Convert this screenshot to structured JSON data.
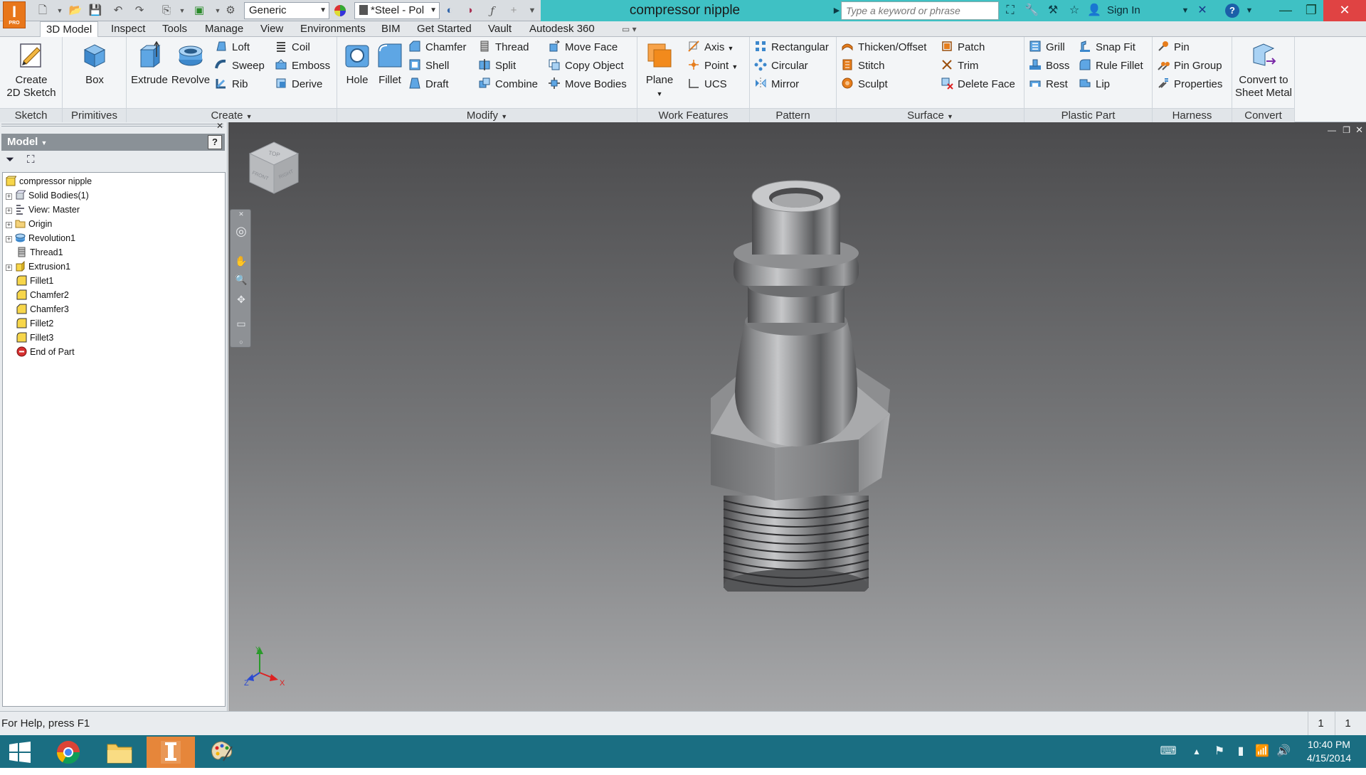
{
  "title_bar": {
    "document_title": "compressor nipple",
    "material": "Generic",
    "appearance": "*Steel - Pol",
    "search_placeholder": "Type a keyword or phrase",
    "sign_in": "Sign In",
    "app_badge": "PRO"
  },
  "tabs": [
    "3D Model",
    "Inspect",
    "Tools",
    "Manage",
    "View",
    "Environments",
    "BIM",
    "Get Started",
    "Vault",
    "Autodesk 360"
  ],
  "ribbon": {
    "sketch": {
      "label": "Sketch",
      "create_2d_sketch": "Create\n2D Sketch"
    },
    "primitives": {
      "label": "Primitives",
      "box": "Box"
    },
    "create": {
      "label": "Create",
      "extrude": "Extrude",
      "revolve": "Revolve",
      "loft": "Loft",
      "sweep": "Sweep",
      "rib": "Rib",
      "coil": "Coil",
      "emboss": "Emboss",
      "derive": "Derive"
    },
    "modify": {
      "label": "Modify",
      "hole": "Hole",
      "fillet": "Fillet",
      "chamfer": "Chamfer",
      "shell": "Shell",
      "draft": "Draft",
      "thread": "Thread",
      "split": "Split",
      "combine": "Combine",
      "move_face": "Move Face",
      "copy_object": "Copy Object",
      "move_bodies": "Move Bodies"
    },
    "work_features": {
      "label": "Work Features",
      "plane": "Plane",
      "axis": "Axis",
      "point": "Point",
      "ucs": "UCS"
    },
    "pattern": {
      "label": "Pattern",
      "rectangular": "Rectangular",
      "circular": "Circular",
      "mirror": "Mirror"
    },
    "surface": {
      "label": "Surface",
      "thicken_offset": "Thicken/Offset",
      "stitch": "Stitch",
      "sculpt": "Sculpt",
      "patch": "Patch",
      "trim": "Trim",
      "delete_face": "Delete Face"
    },
    "plastic_part": {
      "label": "Plastic Part",
      "grill": "Grill",
      "boss": "Boss",
      "rest": "Rest",
      "snap_fit": "Snap Fit",
      "rule_fillet": "Rule Fillet",
      "lip": "Lip"
    },
    "harness": {
      "label": "Harness",
      "pin": "Pin",
      "pin_group": "Pin Group",
      "properties": "Properties"
    },
    "convert": {
      "label": "Convert",
      "convert_to_sheet_metal": "Convert to\nSheet Metal"
    }
  },
  "browser": {
    "header": "Model",
    "tree": [
      {
        "label": "compressor nipple",
        "icon": "part-icon",
        "level": 0,
        "expandable": false
      },
      {
        "label": "Solid Bodies(1)",
        "icon": "solid-bodies-icon",
        "level": 1,
        "expandable": true
      },
      {
        "label": "View: Master",
        "icon": "view-icon",
        "level": 1,
        "expandable": true
      },
      {
        "label": "Origin",
        "icon": "folder-icon",
        "level": 1,
        "expandable": true
      },
      {
        "label": "Revolution1",
        "icon": "revolve-icon",
        "level": 1,
        "expandable": true
      },
      {
        "label": "Thread1",
        "icon": "thread-icon",
        "level": 1,
        "expandable": false
      },
      {
        "label": "Extrusion1",
        "icon": "extrude-icon",
        "level": 1,
        "expandable": true
      },
      {
        "label": "Fillet1",
        "icon": "fillet-icon",
        "level": 1,
        "expandable": false
      },
      {
        "label": "Chamfer2",
        "icon": "chamfer-icon",
        "level": 1,
        "expandable": false
      },
      {
        "label": "Chamfer3",
        "icon": "chamfer-icon",
        "level": 1,
        "expandable": false
      },
      {
        "label": "Fillet2",
        "icon": "fillet-icon",
        "level": 1,
        "expandable": false
      },
      {
        "label": "Fillet3",
        "icon": "fillet-icon",
        "level": 1,
        "expandable": false
      },
      {
        "label": "End of Part",
        "icon": "end-of-part-icon",
        "level": 1,
        "expandable": false
      }
    ]
  },
  "viewcube": {
    "top": "TOP",
    "front": "FRONT",
    "right": "RIGHT"
  },
  "axes": {
    "x": "X",
    "y": "Y",
    "z": "Z"
  },
  "status": {
    "help": "For Help, press F1",
    "count1": "1",
    "count2": "1"
  },
  "taskbar": {
    "time": "10:40 PM",
    "date": "4/15/2014"
  },
  "colors": {
    "title_accent": "#3fc1c4",
    "taskbar": "#1a6e82",
    "app_orange": "#e8761a"
  }
}
